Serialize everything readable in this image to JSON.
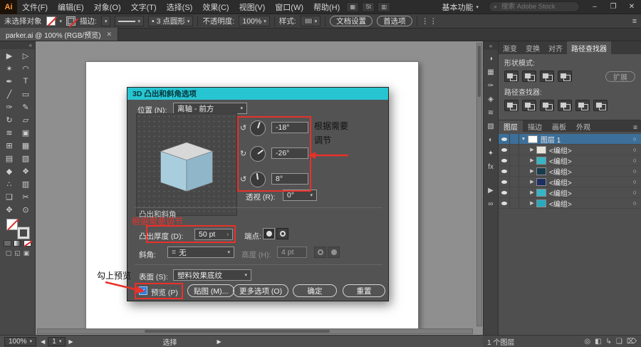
{
  "icons": {
    "caret": "▾",
    "caret_right": "›",
    "chev_left": "◀",
    "chev_right": "▶",
    "expand_down": "▼",
    "expand_right": "▶",
    "close": "✕",
    "minimize": "–",
    "restore": "❐",
    "search": "⌕",
    "menu": "≡",
    "collapse_panel": "«",
    "target": "○",
    "infinity": "∞",
    "play": "▶",
    "check": "✓",
    "bevel_lines": "≡",
    "dot": "•"
  },
  "menubar": {
    "logo": "Ai",
    "items": [
      {
        "label": "文件(F)"
      },
      {
        "label": "编辑(E)"
      },
      {
        "label": "对象(O)"
      },
      {
        "label": "文字(T)"
      },
      {
        "label": "选择(S)"
      },
      {
        "label": "效果(C)"
      },
      {
        "label": "视图(V)"
      },
      {
        "label": "窗口(W)"
      },
      {
        "label": "帮助(H)"
      }
    ],
    "app_icons": [
      {
        "glyph": "▦"
      },
      {
        "glyph": "St"
      },
      {
        "glyph": "▥"
      }
    ],
    "workspace": "基本功能",
    "search_placeholder": "搜索 Adobe Stock"
  },
  "controlbar": {
    "status": "未选择对象",
    "stroke_label": "描边:",
    "shape_value": "3 点圆形",
    "opacity_label": "不透明度:",
    "opacity_value": "100%",
    "style_label": "样式:",
    "doc_setup": "文档设置",
    "preferences": "首选项"
  },
  "tabbar": {
    "title": "parker.ai @ 100% (RGB/预览)"
  },
  "tools": [
    {
      "glyph": "▶"
    },
    {
      "glyph": "▷"
    },
    {
      "glyph": "✶"
    },
    {
      "glyph": "◠"
    },
    {
      "glyph": "✒"
    },
    {
      "glyph": "T"
    },
    {
      "glyph": "╱"
    },
    {
      "glyph": "▭"
    },
    {
      "glyph": "✑"
    },
    {
      "glyph": "✎"
    },
    {
      "glyph": "↻"
    },
    {
      "glyph": "▱"
    },
    {
      "glyph": "≋"
    },
    {
      "glyph": "▣"
    },
    {
      "glyph": "⊞"
    },
    {
      "glyph": "▦"
    },
    {
      "glyph": "▤"
    },
    {
      "glyph": "▧"
    },
    {
      "glyph": "◆"
    },
    {
      "glyph": "❖"
    },
    {
      "glyph": "∴"
    },
    {
      "glyph": "▥"
    },
    {
      "glyph": "❏"
    },
    {
      "glyph": "✂"
    },
    {
      "glyph": "✥"
    },
    {
      "glyph": "⊙"
    }
  ],
  "dialog": {
    "title": "3D 凸出和斜角选项",
    "position_label": "位置 (N):",
    "position_value": "离轴 - 前方",
    "dials": [
      {
        "value": "-18°"
      },
      {
        "value": "-26°"
      },
      {
        "value": "8°"
      }
    ],
    "perspective_label": "透视 (R):",
    "perspective_value": "0°",
    "section_extrude": "凸出和斜角",
    "depth_label": "凸出厚度 (D):",
    "depth_value": "50 pt",
    "caps_label": "端点:",
    "bevel_label": "斜角:",
    "bevel_value": "无",
    "height_label": "高度 (H):",
    "height_value": "4 pt",
    "surface_label": "表面 (S):",
    "surface_value": "塑料效果底纹",
    "preview_label": "预览 (P)",
    "buttons": {
      "map": "贴图 (M)...",
      "more": "更多选项 (O)",
      "ok": "确定",
      "reset": "重置"
    }
  },
  "annotations": {
    "right_line1": "根据需要",
    "right_line2": "调节",
    "mid": "根据需要调节",
    "left": "勾上预览"
  },
  "dock": [
    {
      "glyph": "◑"
    },
    {
      "glyph": "▦"
    },
    {
      "glyph": "✑"
    },
    {
      "glyph": "◈"
    },
    {
      "glyph": "≋"
    },
    {
      "glyph": "▧"
    },
    {
      "glyph": "◐"
    },
    {
      "glyph": "✦"
    },
    {
      "glyph": "fx"
    },
    {
      "glyph": "▶"
    },
    {
      "glyph": "∞"
    }
  ],
  "pathfinder": {
    "tabs": [
      {
        "label": "渐变"
      },
      {
        "label": "变换"
      },
      {
        "label": "对齐"
      },
      {
        "label": "路径查找器"
      }
    ],
    "shape_modes_label": "形状模式:",
    "expand": "扩展",
    "pathfinders_label": "路径查找器:"
  },
  "layers": {
    "tabs": [
      {
        "label": "图层"
      },
      {
        "label": "描边"
      },
      {
        "label": "画板"
      },
      {
        "label": "外观"
      }
    ],
    "root_name": "图层 1",
    "root_thumb_style": "background:#ffffff",
    "groups": [
      {
        "name": "<编组>",
        "thumb_style": "background:#e9e4da"
      },
      {
        "name": "<编组>",
        "thumb_style": "background:#35b6c6"
      },
      {
        "name": "<编组>",
        "thumb_style": "background:#173c4e"
      },
      {
        "name": "<编组>",
        "thumb_style": "background:#1d2f62"
      },
      {
        "name": "<编组>",
        "thumb_style": "background:#35b6c6"
      },
      {
        "name": "<编组>",
        "thumb_style": "background:#2aa9c0"
      }
    ],
    "footer": "1 个图层"
  },
  "statusbar": {
    "zoom": "100%",
    "artboard": "1",
    "status": "选择"
  },
  "colors": {
    "dialog_titlebar": "#27c5d1",
    "annotation_red": "#e8312a",
    "selected_layer": "#3c6f99",
    "cube_top": "#d8d8d8",
    "cube_left": "#a8cede",
    "cube_right": "#8fb6c9"
  }
}
